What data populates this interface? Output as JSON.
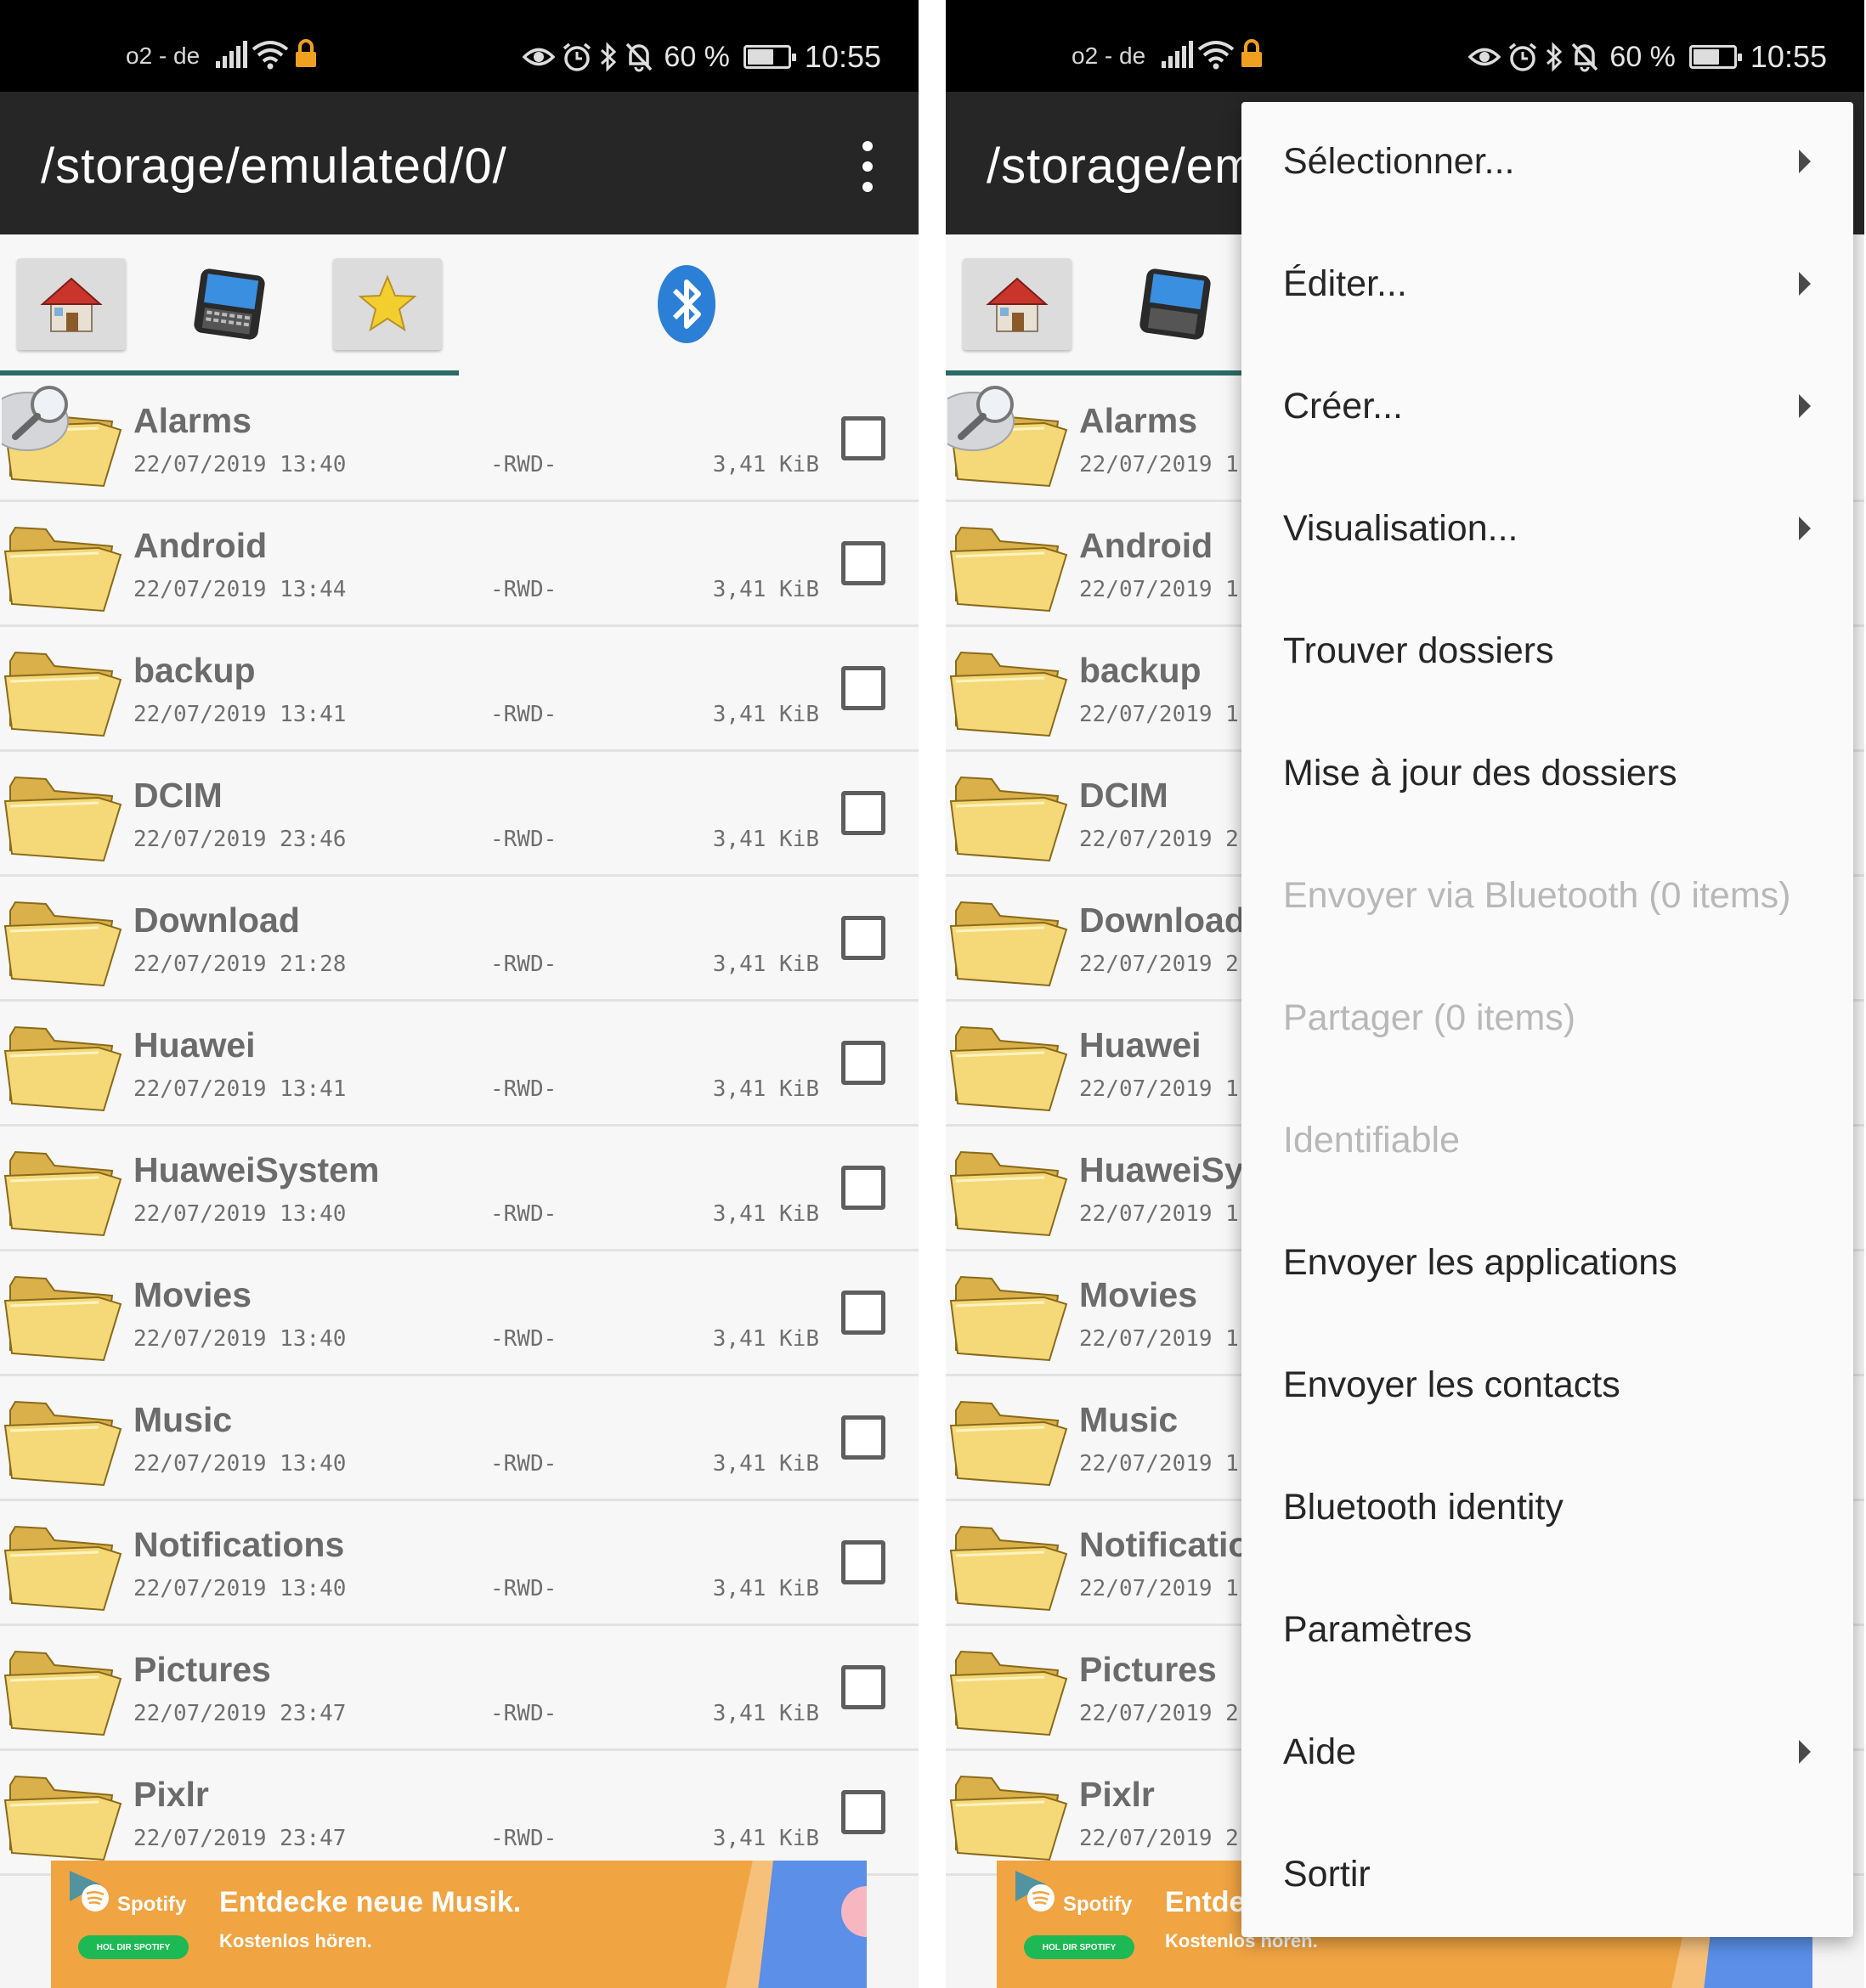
{
  "statusbar": {
    "carrier": "o2 - de",
    "battery": "60 %",
    "battery_level": 0.6,
    "time": "10:55"
  },
  "appbar": {
    "path_full": "/storage/emulated/0/",
    "path_truncated": "/storage/em"
  },
  "toolbar": {
    "buttons": [
      "home-icon",
      "device-icon",
      "star-icon",
      "bluetooth-icon"
    ]
  },
  "files": [
    {
      "name": "Alarms",
      "date": "22/07/2019 13:40",
      "date_truncated": "22/07/2019 1",
      "perm": "-RWD-",
      "size": "3,41 KiB"
    },
    {
      "name": "Android",
      "date": "22/07/2019 13:44",
      "date_truncated": "22/07/2019 1",
      "perm": "-RWD-",
      "size": "3,41 KiB"
    },
    {
      "name": "backup",
      "date": "22/07/2019 13:41",
      "date_truncated": "22/07/2019 1",
      "perm": "-RWD-",
      "size": "3,41 KiB"
    },
    {
      "name": "DCIM",
      "date": "22/07/2019 23:46",
      "date_truncated": "22/07/2019 2",
      "perm": "-RWD-",
      "size": "3,41 KiB"
    },
    {
      "name": "Download",
      "date": "22/07/2019 21:28",
      "date_truncated": "22/07/2019 2",
      "perm": "-RWD-",
      "size": "3,41 KiB"
    },
    {
      "name": "Huawei",
      "date": "22/07/2019 13:41",
      "date_truncated": "22/07/2019 1",
      "perm": "-RWD-",
      "size": "3,41 KiB"
    },
    {
      "name": "HuaweiSystem",
      "name_truncated": "HuaweiSy",
      "date": "22/07/2019 13:40",
      "date_truncated": "22/07/2019 1",
      "perm": "-RWD-",
      "size": "3,41 KiB"
    },
    {
      "name": "Movies",
      "date": "22/07/2019 13:40",
      "date_truncated": "22/07/2019 1",
      "perm": "-RWD-",
      "size": "3,41 KiB"
    },
    {
      "name": "Music",
      "date": "22/07/2019 13:40",
      "date_truncated": "22/07/2019 1",
      "perm": "-RWD-",
      "size": "3,41 KiB"
    },
    {
      "name": "Notifications",
      "name_truncated": "Notificatio",
      "date": "22/07/2019 13:40",
      "date_truncated": "22/07/2019 1",
      "perm": "-RWD-",
      "size": "3,41 KiB"
    },
    {
      "name": "Pictures",
      "date": "22/07/2019 23:47",
      "date_truncated": "22/07/2019 2",
      "perm": "-RWD-",
      "size": "3,41 KiB"
    },
    {
      "name": "Pixlr",
      "date": "22/07/2019 23:47",
      "date_truncated": "22/07/2019 2",
      "perm": "-RWD-",
      "size": "3,41 KiB"
    }
  ],
  "ad": {
    "brand": "Spotify",
    "cta": "HOL DIR SPOTIFY",
    "headline": "Entdecke neue Musik.",
    "headline_truncated": "Entde",
    "subline": "Kostenlos hören.",
    "subline_truncated": "Kostenlos hören.",
    "bg_color": "#f0a442"
  },
  "menu": {
    "items": [
      {
        "label": "Sélectionner...",
        "submenu": true,
        "enabled": true
      },
      {
        "label": "Éditer...",
        "submenu": true,
        "enabled": true
      },
      {
        "label": "Créer...",
        "submenu": true,
        "enabled": true
      },
      {
        "label": "Visualisation...",
        "submenu": true,
        "enabled": true
      },
      {
        "label": "Trouver dossiers",
        "submenu": false,
        "enabled": true
      },
      {
        "label": "Mise à jour des dossiers",
        "submenu": false,
        "enabled": true
      },
      {
        "label": "Envoyer via Bluetooth (0 items)",
        "submenu": false,
        "enabled": false
      },
      {
        "label": "Partager (0 items)",
        "submenu": false,
        "enabled": false
      },
      {
        "label": "Identifiable",
        "submenu": false,
        "enabled": false
      },
      {
        "label": "Envoyer les applications",
        "submenu": false,
        "enabled": true
      },
      {
        "label": "Envoyer les contacts",
        "submenu": false,
        "enabled": true
      },
      {
        "label": "Bluetooth identity",
        "submenu": false,
        "enabled": true
      },
      {
        "label": "Paramètres",
        "submenu": false,
        "enabled": true
      },
      {
        "label": "Aide",
        "submenu": true,
        "enabled": true
      },
      {
        "label": "Sortir",
        "submenu": false,
        "enabled": true
      }
    ]
  },
  "colors": {
    "statusbar": "#000000",
    "appbar": "#262626",
    "tab_indicator": "#2b6b66",
    "folder": "#f5d878"
  }
}
